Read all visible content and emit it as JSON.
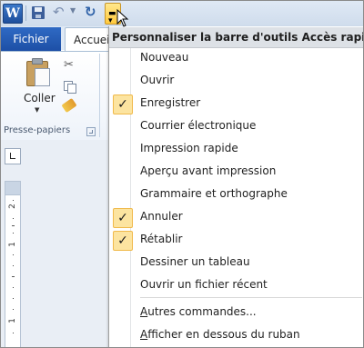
{
  "qat": {
    "app_icon_letter": "W",
    "customize_tooltip_title": "Personnaliser la barre d'outils Accès rapide"
  },
  "tabs": [
    {
      "label": "Fichier"
    },
    {
      "label": "Accueil"
    }
  ],
  "ribbon": {
    "paste_label": "Coller",
    "group_label": "Presse-papiers"
  },
  "ruler": {
    "numbers": [
      "2",
      "1",
      "1"
    ]
  },
  "menu": {
    "title": "Personnaliser la barre d'outils Accès rapide",
    "items": [
      {
        "label": "Nouveau",
        "checked": false
      },
      {
        "label": "Ouvrir",
        "checked": false
      },
      {
        "label": "Enregistrer",
        "checked": true
      },
      {
        "label": "Courrier électronique",
        "checked": false
      },
      {
        "label": "Impression rapide",
        "checked": false
      },
      {
        "label": "Aperçu avant impression",
        "checked": false
      },
      {
        "label": "Grammaire et orthographe",
        "checked": false
      },
      {
        "label": "Annuler",
        "checked": true
      },
      {
        "label": "Rétablir",
        "checked": true
      },
      {
        "label": "Dessiner un tableau",
        "checked": false
      },
      {
        "label": "Ouvrir un fichier récent",
        "checked": false
      }
    ],
    "more_commands": {
      "access_key": "A",
      "rest": "utres commandes..."
    },
    "show_below": {
      "access_key": "A",
      "rest": "fficher en dessous du ruban"
    },
    "check_glyph": "✓"
  },
  "colors": {
    "file_tab": "#2f6ac4",
    "check_highlight": "#fce4a0",
    "menu_title_bg": "#dde1e6"
  }
}
